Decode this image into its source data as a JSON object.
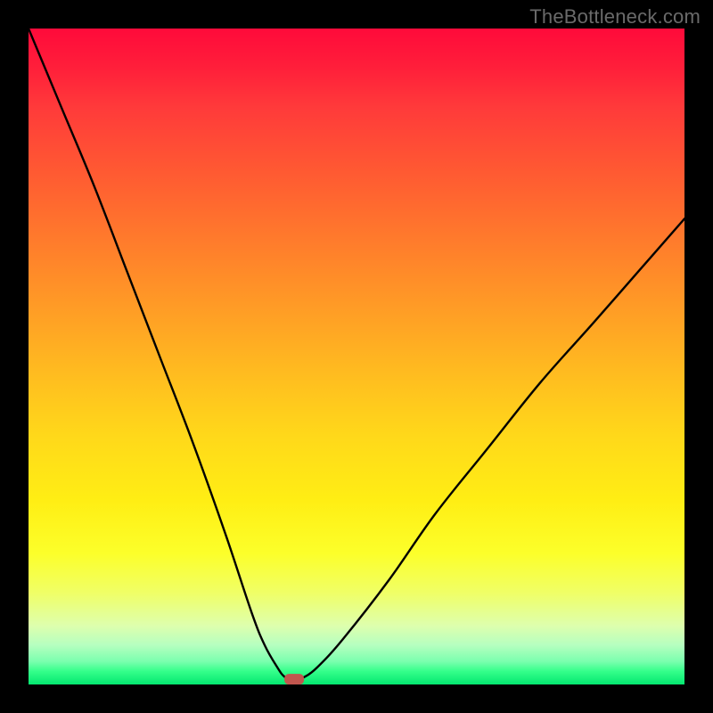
{
  "watermark": "TheBottleneck.com",
  "chart_data": {
    "type": "line",
    "title": "",
    "xlabel": "",
    "ylabel": "",
    "xlim": [
      0,
      100
    ],
    "ylim": [
      0,
      100
    ],
    "grid": false,
    "legend": false,
    "series": [
      {
        "name": "bottleneck-curve",
        "x": [
          0,
          5,
          10,
          15,
          20,
          25,
          30,
          34,
          36,
          38,
          39,
          40,
          41,
          42,
          44,
          48,
          55,
          62,
          70,
          78,
          86,
          93,
          100
        ],
        "y": [
          100,
          88,
          76,
          63,
          50,
          37,
          23,
          11,
          6,
          2.5,
          1.2,
          0.8,
          0.8,
          1.1,
          2.6,
          7,
          16,
          26,
          36,
          46,
          55,
          63,
          71
        ]
      }
    ],
    "marker": {
      "x": 40.5,
      "y": 0.8,
      "color": "#c1564e"
    },
    "annotations": []
  },
  "colors": {
    "frame": "#000000",
    "gradient_top": "#ff0a3a",
    "gradient_mid": "#ffd81a",
    "gradient_bottom": "#04e770",
    "curve_stroke": "#000000",
    "marker_fill": "#c1564e",
    "watermark_text": "#6a6a6a"
  }
}
